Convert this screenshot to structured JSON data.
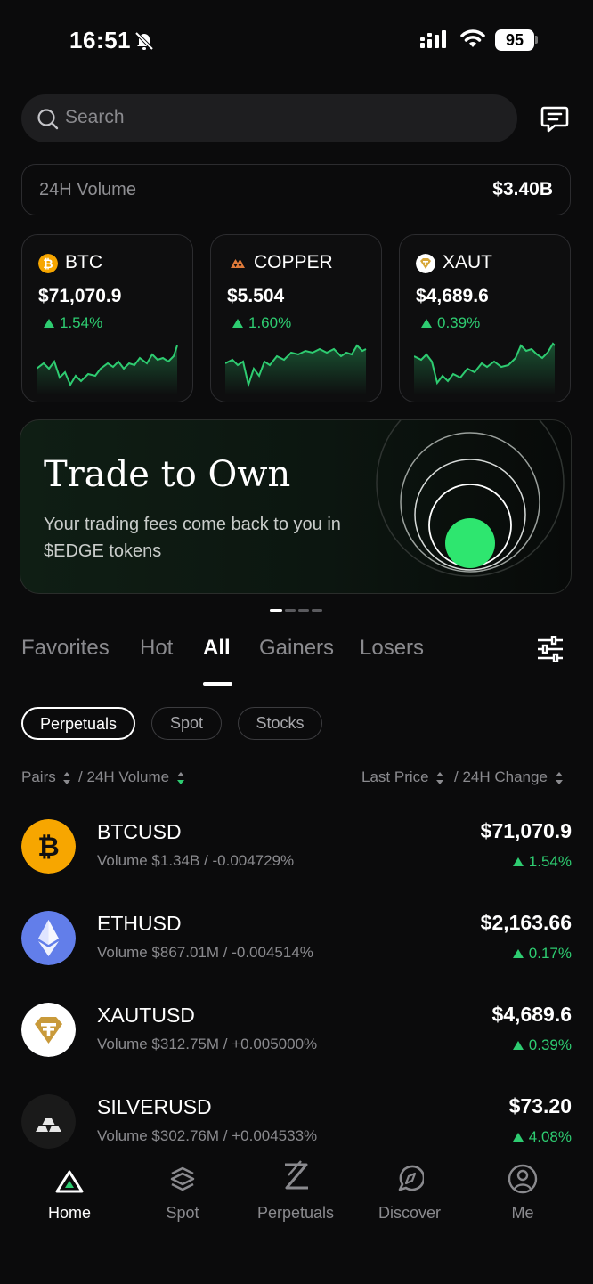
{
  "status": {
    "time": "16:51",
    "battery": "95"
  },
  "search": {
    "placeholder": "Search"
  },
  "volume": {
    "label": "24H Volume",
    "value": "$3.40B"
  },
  "tickers": [
    {
      "name": "BTC",
      "price": "$71,070.9",
      "change": "1.54%"
    },
    {
      "name": "COPPER",
      "price": "$5.504",
      "change": "1.60%"
    },
    {
      "name": "XAUT",
      "price": "$4,689.6",
      "change": "0.39%"
    }
  ],
  "banner": {
    "title": "Trade to Own",
    "subtitle": "Your trading fees come back to you in $EDGE tokens"
  },
  "tabs": [
    "Favorites",
    "Hot",
    "All",
    "Gainers",
    "Losers"
  ],
  "active_tab": "All",
  "chips": [
    "Perpetuals",
    "Spot",
    "Stocks"
  ],
  "columns": {
    "pairs": "Pairs",
    "volume": "/  24H Volume",
    "price": "Last Price",
    "change": "/  24H Change"
  },
  "markets": [
    {
      "symbol": "BTCUSD",
      "sub": "Volume $1.34B / -0.004729%",
      "price": "$71,070.9",
      "change": "1.54%"
    },
    {
      "symbol": "ETHUSD",
      "sub": "Volume $867.01M / -0.004514%",
      "price": "$2,163.66",
      "change": "0.17%"
    },
    {
      "symbol": "XAUTUSD",
      "sub": "Volume $312.75M / +0.005000%",
      "price": "$4,689.6",
      "change": "0.39%"
    },
    {
      "symbol": "SILVERUSD",
      "sub": "Volume $302.76M / +0.004533%",
      "price": "$73.20",
      "change": "4.08%"
    }
  ],
  "nav": [
    "Home",
    "Spot",
    "Perpetuals",
    "Discover",
    "Me"
  ],
  "colors": {
    "accent_green": "#2ecc71",
    "btc_orange": "#f7a600",
    "eth_purple": "#627eea",
    "banner_dot": "#2ee66f"
  }
}
